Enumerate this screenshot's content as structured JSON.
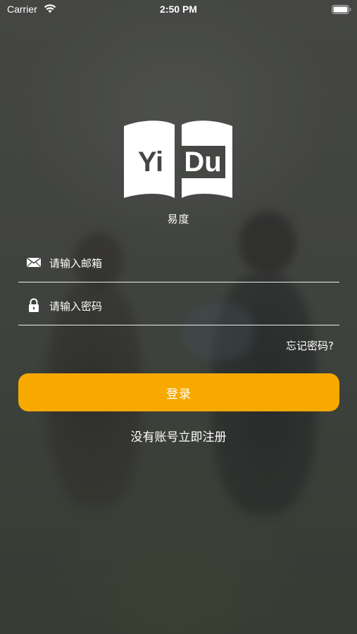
{
  "status_bar": {
    "carrier": "Carrier",
    "time": "2:50 PM",
    "wifi_icon": "wifi-icon",
    "battery_icon": "battery-full-icon"
  },
  "logo": {
    "left_text": "Yi",
    "right_text": "Du",
    "icon": "open-book-icon"
  },
  "app_name": "易度",
  "login_form": {
    "email": {
      "icon": "mail-icon",
      "placeholder": "请输入邮箱",
      "value": ""
    },
    "password": {
      "icon": "lock-icon",
      "placeholder": "请输入密码",
      "value": ""
    },
    "forgot_password": "忘记密码?",
    "login_button": "登录",
    "register_link": "没有账号立即注册"
  },
  "colors": {
    "accent": "#f7a900",
    "text": "#ffffff",
    "background": "#444641"
  }
}
